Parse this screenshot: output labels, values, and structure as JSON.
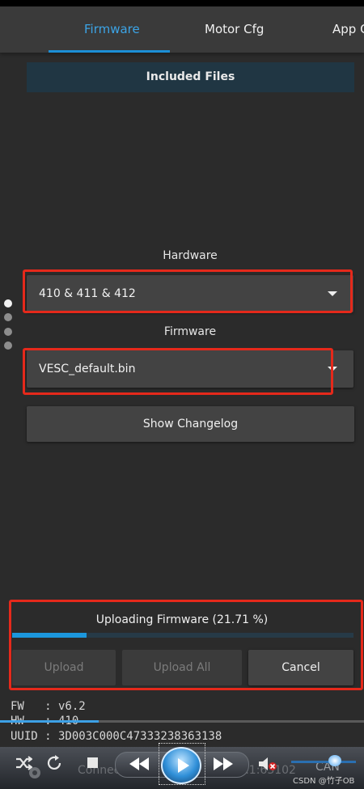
{
  "tabs": [
    {
      "label": "Firmware",
      "active": true
    },
    {
      "label": "Motor Cfg",
      "active": false
    },
    {
      "label": "App C",
      "active": false
    }
  ],
  "files_header": "Included Files",
  "hardware": {
    "label": "Hardware",
    "selected": "410 & 411 & 412"
  },
  "firmware": {
    "label": "Firmware",
    "selected": "VESC_default.bin"
  },
  "changelog_button": "Show Changelog",
  "upload": {
    "title": "Uploading Firmware (21.71 %)",
    "progress_percent": 21.71,
    "buttons": {
      "upload": "Upload",
      "upload_all": "Upload All",
      "cancel": "Cancel"
    }
  },
  "console": {
    "fw": "FW   : v6.2",
    "hw": "HW   : 410",
    "uuid": "UUID : 3D003C000C47333238363138"
  },
  "player": {
    "status": "Connected (TC",
    "status_tail": "168.4.1:63102",
    "can": "CAN"
  },
  "watermark": "CSDN @竹子OB",
  "colors": {
    "accent": "#1c8fd6",
    "highlight": "#e5291b"
  }
}
